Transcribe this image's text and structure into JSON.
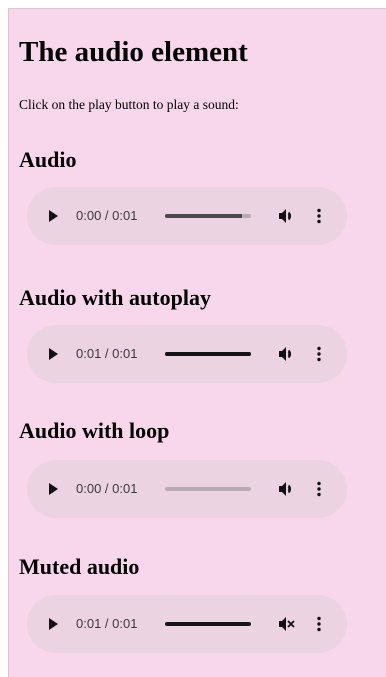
{
  "page": {
    "title": "The audio element",
    "intro": "Click on the play button to play a sound:"
  },
  "sections": [
    {
      "heading": "Audio",
      "player": {
        "time": "0:00 / 0:01",
        "progress": 0.9,
        "muted": false,
        "state": "paused"
      }
    },
    {
      "heading": "Audio with autoplay",
      "player": {
        "time": "0:01 / 0:01",
        "progress": 1.0,
        "muted": false,
        "state": "ended"
      }
    },
    {
      "heading": "Audio with loop",
      "player": {
        "time": "0:00 / 0:01",
        "progress": 0.0,
        "muted": false,
        "state": "paused"
      }
    },
    {
      "heading": "Muted audio",
      "player": {
        "time": "0:01 / 0:01",
        "progress": 1.0,
        "muted": true,
        "state": "ended"
      }
    }
  ],
  "icons": {
    "play": "play-icon",
    "volume": "volume-icon",
    "muted": "volume-muted-icon",
    "menu": "more-options-icon"
  }
}
